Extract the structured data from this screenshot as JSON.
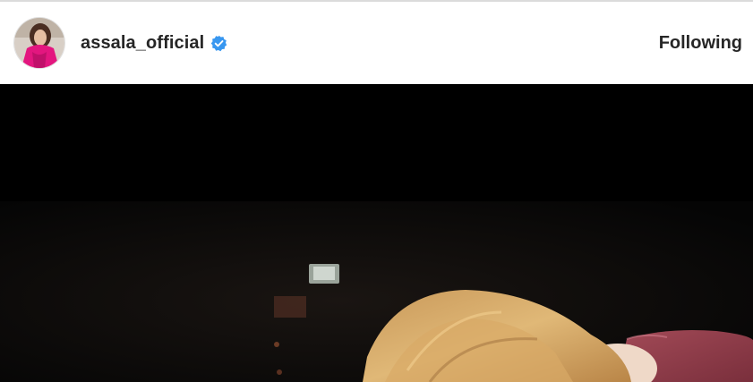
{
  "post": {
    "header": {
      "username": "assala_official",
      "verified": true,
      "follow_label": "Following",
      "verified_icon_color": "#3897f0"
    },
    "media": {
      "type": "video-still",
      "description_icon": "photo"
    }
  }
}
